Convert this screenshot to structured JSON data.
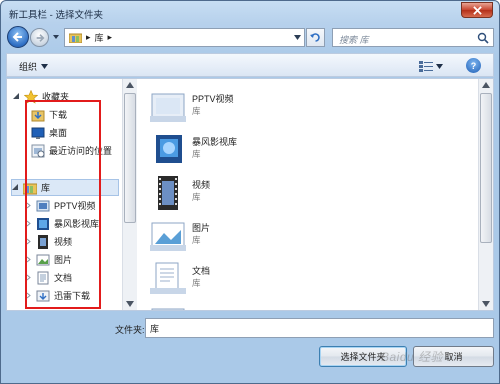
{
  "window": {
    "title": "新工具栏 - 选择文件夹"
  },
  "address": {
    "crumbs": [
      "库"
    ]
  },
  "search": {
    "placeholder": "搜索 库"
  },
  "commandbar": {
    "organize_label": "组织"
  },
  "nav_tree": {
    "favorites": {
      "label": "收藏夹",
      "items": [
        "下载",
        "桌面",
        "最近访问的位置"
      ]
    },
    "libraries": {
      "label": "库",
      "items": [
        "PPTV视频",
        "暴风影视库",
        "视频",
        "图片",
        "文档",
        "迅雷下载"
      ]
    }
  },
  "files": [
    {
      "name": "PPTV视频",
      "type": "库"
    },
    {
      "name": "暴风影视库",
      "type": "库"
    },
    {
      "name": "视频",
      "type": "库"
    },
    {
      "name": "图片",
      "type": "库"
    },
    {
      "name": "文档",
      "type": "库"
    }
  ],
  "footer": {
    "folder_label": "文件夹:",
    "folder_value": "库",
    "select_button": "选择文件夹",
    "cancel_button": "取消"
  },
  "watermark": "Baidu 经验",
  "colors": {
    "highlight_box": "#e21b1b",
    "selection": "#dbe8f7",
    "window_frame": "#b7d1ec"
  },
  "icons": {
    "favorites": "star-icon",
    "download": "download-folder-icon",
    "desktop": "desktop-icon",
    "recent": "recent-places-icon",
    "library": "library-icon",
    "video": "video-library-icon",
    "picture": "picture-library-icon",
    "document": "document-library-icon"
  }
}
